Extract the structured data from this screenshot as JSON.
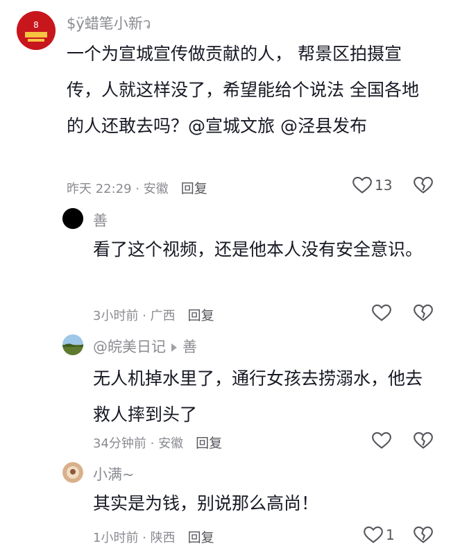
{
  "colors": {
    "text": "#161823",
    "muted": "#8a8b91",
    "reply": "#55565c",
    "icon": "#55565c"
  },
  "comments": [
    {
      "author": "$ÿ蜡笔小新ว",
      "text": "一个为宣城宣传做贡献的人， 帮景区拍摄宣传，人就这样没了，希望能给个说法 全国各地的人还敢去吗？@宣城文旅 @泾县发布",
      "meta": "昨天 22:29 · 安徽",
      "reply_label": "回复",
      "likes": "13",
      "avatar_icon": "red-badge-avatar"
    },
    {
      "author": "善",
      "text": "看了这个视频，还是他本人没有安全意识。",
      "meta": "3小时前 · 广西",
      "reply_label": "回复",
      "likes": "",
      "avatar_icon": "black-dot-avatar"
    },
    {
      "author": "@皖美日记",
      "reply_to": "善",
      "text": "无人机掉水里了，通行女孩去捞溺水，他去救人摔到头了",
      "meta": "34分钟前 · 安徽",
      "reply_label": "回复",
      "likes": "",
      "avatar_icon": "landscape-avatar"
    },
    {
      "author": "小满~",
      "text": "其实是为钱，别说那么高尚！",
      "meta": "1小时前 · 陕西",
      "reply_label": "回复",
      "likes": "1",
      "avatar_icon": "portrait-avatar"
    }
  ]
}
